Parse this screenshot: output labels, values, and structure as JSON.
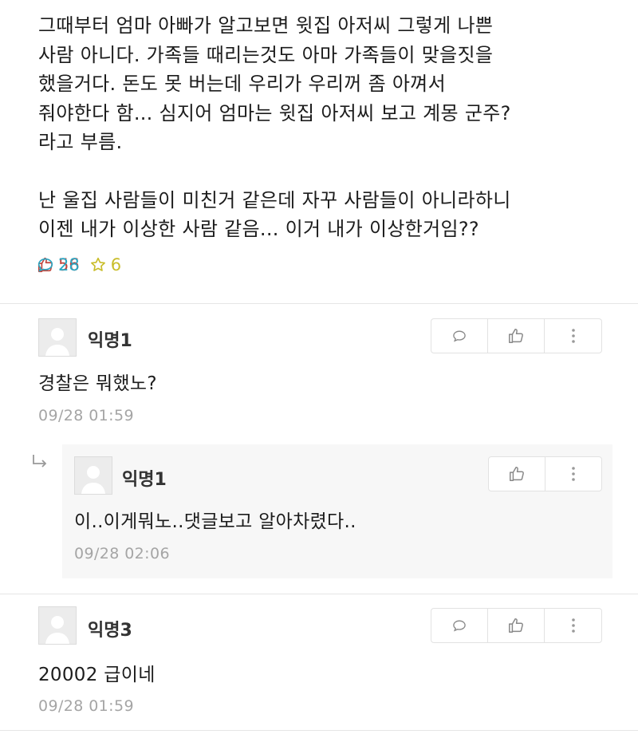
{
  "post": {
    "lines": [
      "그때부터 엄마 아빠가 알고보면 윗집 아저씨 그렇게 나쁜",
      "사람 아니다. 가족들 때리는것도 아마 가족들이 맞을짓을",
      "했을거다. 돈도 못 버는데 우리가 우리꺼 좀 아껴서",
      "줘야한다 함... 심지어 엄마는 윗집 아저씨 보고 계몽 군주?",
      "라고 부름.",
      "난 울집 사람들이 미친거 같은데 자꾸 사람들이 아니라하니",
      "이젠 내가 이상한 사람 같음... 이거 내가 이상한거임??"
    ],
    "stats": {
      "likes": "56",
      "comments": "28",
      "scraps": "6"
    }
  },
  "comments": [
    {
      "author": "익명1",
      "text": "경찰은 뭐했노?",
      "time": "09/28 01:59",
      "reply": {
        "author": "익명1",
        "text": "이..이게뭐노..댓글보고 알아차렸다..",
        "time": "09/28 02:06"
      }
    },
    {
      "author": "익명3",
      "text": "20002 급이네",
      "time": "09/28 01:59"
    }
  ],
  "colors": {
    "like": "#c1453c",
    "comment": "#2aa6c2",
    "scrap": "#c9bd2a",
    "time": "#a5a5a5",
    "reply_bg": "#f7f7f7"
  },
  "icons": {
    "like": "thumbs-up-icon",
    "comment": "speech-bubble-icon",
    "scrap": "star-icon",
    "more": "more-vertical-icon",
    "reply": "reply-arrow-icon",
    "avatar": "default-avatar-icon"
  }
}
